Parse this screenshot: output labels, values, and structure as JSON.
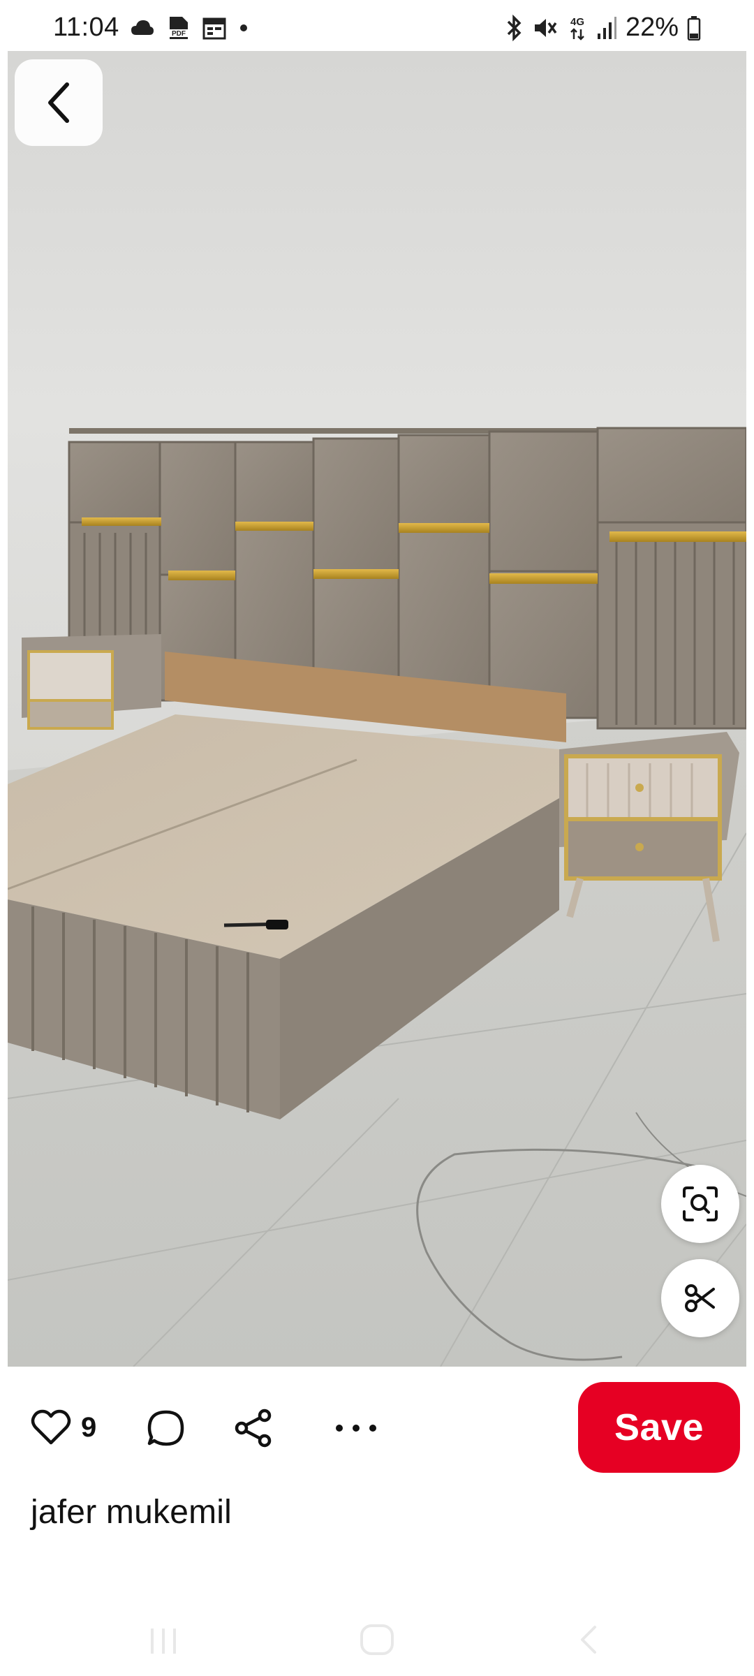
{
  "status_bar": {
    "time": "11:04",
    "left_icons": [
      "cloud-icon",
      "pdf-icon",
      "calendar-icon",
      "dot-icon"
    ],
    "right_icons": [
      "bluetooth-icon",
      "mute-icon",
      "4g-icon",
      "signal-icon"
    ],
    "network_label": "4G",
    "battery_percent": "22%",
    "battery_icon": "battery-icon"
  },
  "pin": {
    "image_subject": "upholstered bed with panel headboard and nightstands",
    "back_icon": "chevron-left-icon",
    "visual_search_icon": "lens-search-icon",
    "cutout_icon": "scissors-icon"
  },
  "actions": {
    "like_icon": "heart-icon",
    "like_count": "9",
    "comment_icon": "comment-icon",
    "share_icon": "share-icon",
    "more_icon": "more-horizontal-icon",
    "save_label": "Save"
  },
  "author": {
    "name": "jafer mukemil"
  },
  "nav_bar": {
    "recents_icon": "recents-icon",
    "home_icon": "home-icon",
    "back_icon": "back-icon"
  },
  "colors": {
    "save_red": "#e60023",
    "headboard": "#8e857a",
    "gold_trim": "#c7a035"
  }
}
